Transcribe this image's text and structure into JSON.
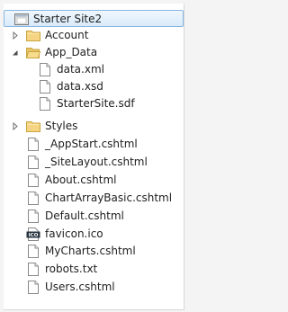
{
  "tree": {
    "root": {
      "label": "Starter Site2"
    },
    "items": [
      {
        "label": "Account",
        "icon": "folder-icon",
        "toggle": "collapsed"
      },
      {
        "label": "App_Data",
        "icon": "folder-icon",
        "toggle": "expanded"
      },
      {
        "label": "data.xml",
        "icon": "file-icon"
      },
      {
        "label": "data.xsd",
        "icon": "file-icon"
      },
      {
        "label": "StarterSite.sdf",
        "icon": "file-icon"
      },
      {
        "label": "Styles",
        "icon": "folder-icon",
        "toggle": "collapsed"
      },
      {
        "label": "_AppStart.cshtml",
        "icon": "file-icon"
      },
      {
        "label": "_SiteLayout.cshtml",
        "icon": "file-icon"
      },
      {
        "label": "About.cshtml",
        "icon": "file-icon"
      },
      {
        "label": "ChartArrayBasic.cshtml",
        "icon": "file-icon"
      },
      {
        "label": "Default.cshtml",
        "icon": "file-icon"
      },
      {
        "label": "favicon.ico",
        "icon": "ico-file-icon",
        "badge": "ICO"
      },
      {
        "label": "MyCharts.cshtml",
        "icon": "file-icon"
      },
      {
        "label": "robots.txt",
        "icon": "file-icon"
      },
      {
        "label": "Users.cshtml",
        "icon": "file-icon"
      }
    ]
  },
  "colors": {
    "selection": "#d8eaf9",
    "selection_border": "#8ab6e1",
    "folder": "#f5d583",
    "folder_border": "#c9a43c"
  }
}
